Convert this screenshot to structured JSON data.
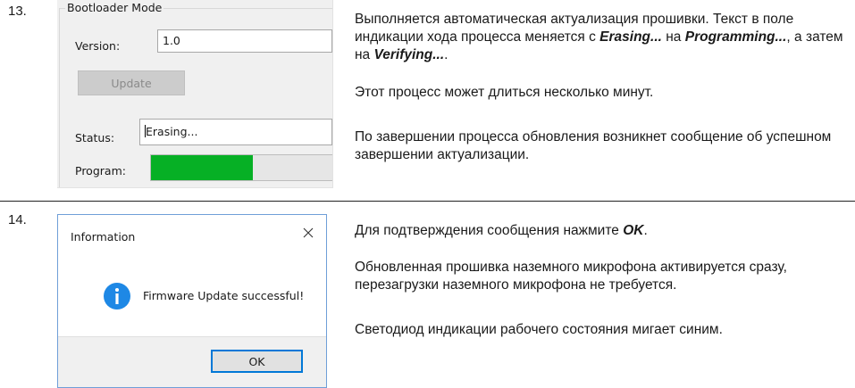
{
  "steps": [
    {
      "number": "13.",
      "screenshot": {
        "group_title": "Bootloader Mode",
        "version_label": "Version:",
        "version_value": "1.0",
        "update_button": "Update",
        "status_label": "Status:",
        "status_value": "Erasing...",
        "program_label": "Program:",
        "progress_fraction": 0.55,
        "progress_color": "#06b025"
      },
      "p1_a": "Выполняется автоматическая актуализация прошивки. Текст в поле индикации хода процесса меняется с ",
      "p1_b1": "Erasing...",
      "p1_c": " на ",
      "p1_b2": "Programming...",
      "p1_d": ", а затем на ",
      "p1_b3": "Verifying...",
      "p1_e": ".",
      "p2": "Этот процесс может длиться несколько минут.",
      "p3": "По завершении процесса обновления возникнет сообщение об успешном завершении актуализации."
    },
    {
      "number": "14.",
      "dialog": {
        "title": "Information",
        "message": "Firmware Update successful!",
        "ok_button": "OK",
        "icon": "info-icon",
        "icon_color": "#1e88e5"
      },
      "p1_a": "Для подтверждения сообщения нажмите ",
      "p1_b": "OK",
      "p1_c": ".",
      "p2": "Обновленная прошивка наземного микрофона активируется сразу, перезагрузки наземного микрофона не требуется.",
      "p3": "Светодиод индикации рабочего состояния мигает синим."
    }
  ]
}
